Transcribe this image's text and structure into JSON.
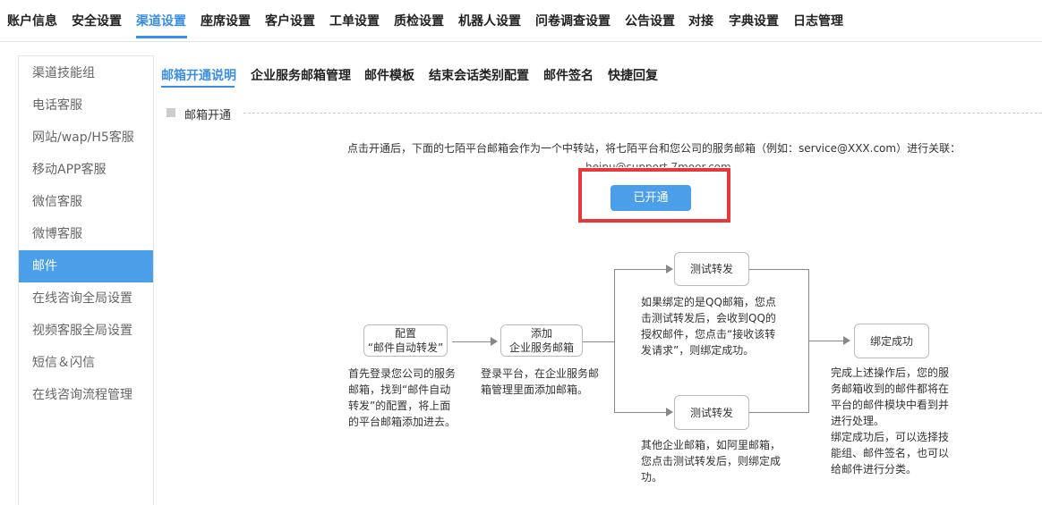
{
  "topnav": {
    "items": [
      "账户信息",
      "安全设置",
      "渠道设置",
      "座席设置",
      "客户设置",
      "工单设置",
      "质检设置",
      "机器人设置",
      "问卷调查设置",
      "公告设置",
      "对接",
      "字典设置",
      "日志管理"
    ],
    "active": "渠道设置"
  },
  "sidebar": {
    "items": [
      "渠道技能组",
      "电话客服",
      "网站/wap/H5客服",
      "移动APP客服",
      "微信客服",
      "微博客服",
      "邮件",
      "在线咨询全局设置",
      "视频客服全局设置",
      "短信＆闪信",
      "在线咨询流程管理"
    ],
    "active": "邮件"
  },
  "subtabs": {
    "items": [
      "邮箱开通说明",
      "企业服务邮箱管理",
      "邮件模板",
      "结束会话类别配置",
      "邮件签名",
      "快捷回复"
    ],
    "active": "邮箱开通说明"
  },
  "section": {
    "title": "邮箱开通",
    "description": "点击开通后，下面的七陌平台邮箱会作为一个中转站，将七陌平台和您公司的服务邮箱（例如：service@XXX.com）进行关联：",
    "email": "heipu@support.7moor.com",
    "open_button": "已开通"
  },
  "flow": {
    "step1": {
      "line1": "配置",
      "line2": "“邮件自动转发”",
      "desc": [
        "首先登录您公司的服务",
        "邮箱，找到“邮件自动",
        "转发”的配置，将上面",
        "的平台邮箱添加进去。"
      ]
    },
    "step2": {
      "line1": "添加",
      "line2": "企业服务邮箱",
      "desc": [
        "登录平台，在企业服务邮",
        "箱管理里面添加邮箱。"
      ]
    },
    "test_top": {
      "label": "测试转发",
      "desc": [
        "如果绑定的是QQ邮箱，您点",
        "击测试转发后，会收到QQ的",
        "授权邮件，您点击“接收该转",
        "发请求”，则绑定成功。"
      ]
    },
    "test_bottom": {
      "label": "测试转发",
      "desc": [
        "其他企业邮箱，如阿里邮箱，",
        "您点击测试转发后，则绑定成",
        "功。"
      ]
    },
    "success": {
      "label": "绑定成功",
      "desc": [
        "完成上述操作后，您的服",
        "务邮箱收到的邮件都将在",
        "平台的邮件模块中看到并",
        "进行处理。",
        "绑定成功后，可以选择技",
        "能组、邮件签名，也可以",
        "给邮件进行分类。"
      ]
    }
  },
  "colors": {
    "accent": "#4a9fe8",
    "highlight_box": "#e8393a"
  }
}
